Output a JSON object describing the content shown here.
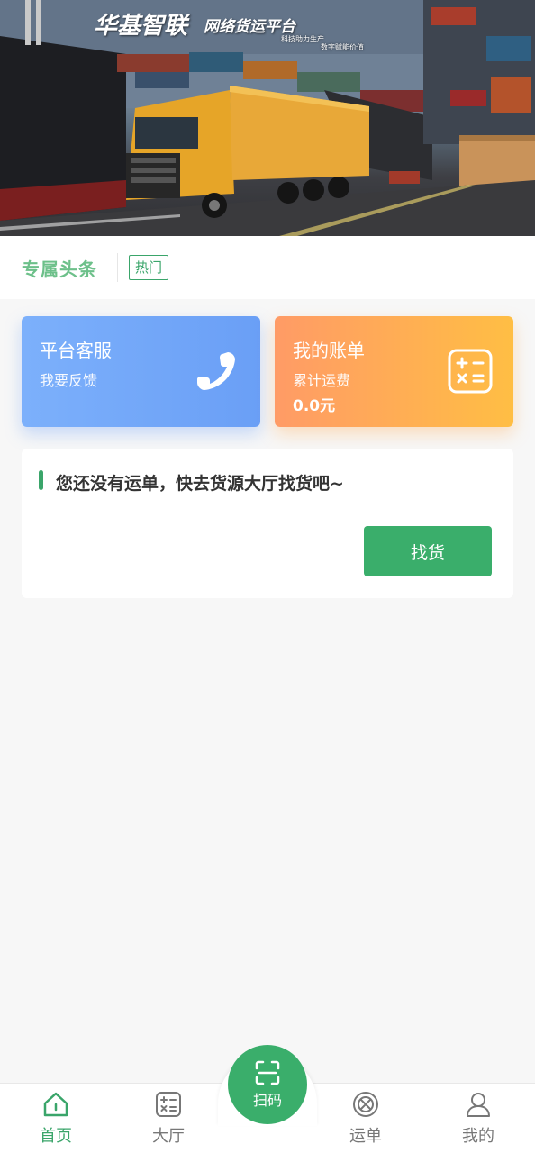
{
  "banner": {
    "title": "华基智联",
    "subtitle": "网络货运平台",
    "slogan1": "科技助力生产",
    "slogan2": "数字赋能价值"
  },
  "headline": {
    "title": "专属头条",
    "tag": "热门"
  },
  "cards": {
    "service": {
      "title": "平台客服",
      "sub": "我要反馈",
      "icon": "phone-icon"
    },
    "bill": {
      "title": "我的账单",
      "sub": "累计运费",
      "amount": "0.0元",
      "icon": "calculator-icon"
    }
  },
  "notice": {
    "text": "您还没有运单，快去货源大厅找货吧~",
    "button": "找货"
  },
  "tabbar": {
    "items": [
      {
        "label": "首页",
        "icon": "home-icon",
        "active": true
      },
      {
        "label": "大厅",
        "icon": "calculator-icon",
        "active": false
      },
      {
        "label": "运单",
        "icon": "wheel-icon",
        "active": false
      },
      {
        "label": "我的",
        "icon": "user-icon",
        "active": false
      }
    ],
    "scan": {
      "label": "扫码",
      "icon": "scan-icon"
    }
  },
  "colors": {
    "accent": "#3aae6b",
    "headline_title": "#6dc08a",
    "service_card": "#7cb0fb",
    "bill_card": "#ffaf55"
  }
}
